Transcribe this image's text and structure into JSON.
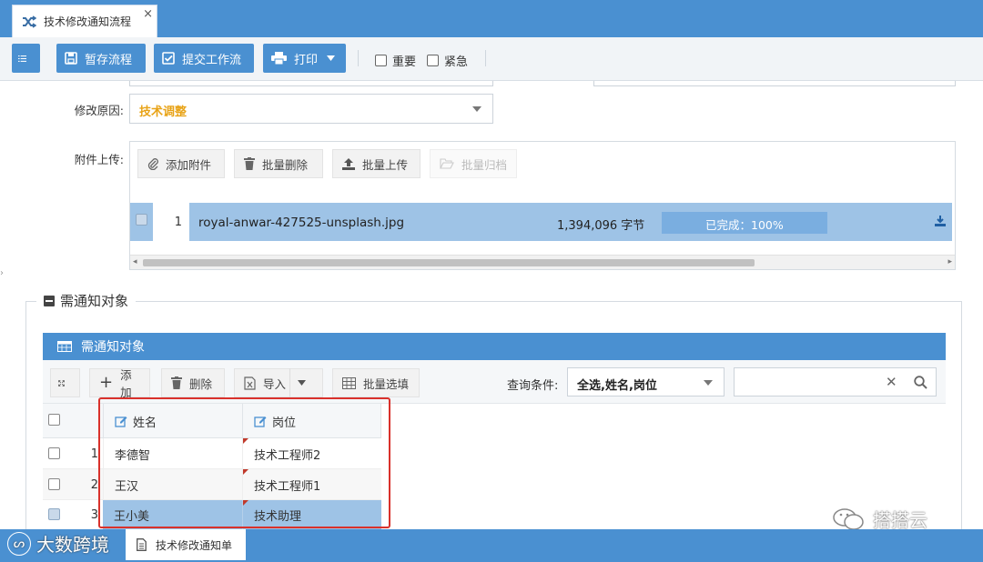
{
  "window": {
    "tab_title": "技术修改通知流程",
    "close_glyph": "×"
  },
  "toolbar": {
    "save_draft": "暂存流程",
    "submit": "提交工作流",
    "print": "打印",
    "important": "重要",
    "urgent": "紧急"
  },
  "form": {
    "reason_label": "修改原因:",
    "reason_value": "技术调整",
    "attach_label": "附件上传:",
    "attach_buttons": {
      "add": "添加附件",
      "batch_delete": "批量删除",
      "batch_upload": "批量上传",
      "batch_archive": "批量归档"
    },
    "file": {
      "index": "1",
      "name": "royal-anwar-427525-unsplash.jpg",
      "size": "1,394,096 字节",
      "status": "已完成：100%",
      "progress": 1.0
    }
  },
  "notify": {
    "section_title": "需通知对象",
    "panel_title": "需通知对象",
    "buttons": {
      "add": "添加",
      "delete": "删除",
      "import": "导入",
      "batch_fill": "批量选填"
    },
    "query_label": "查询条件:",
    "query_value": "全选,姓名,岗位",
    "columns": [
      "姓名",
      "岗位"
    ],
    "rows": [
      {
        "no": "1",
        "name": "李德智",
        "post": "技术工程师2",
        "checked": false
      },
      {
        "no": "2",
        "name": "王汉",
        "post": "技术工程师1",
        "checked": false
      },
      {
        "no": "3",
        "name": "王小美",
        "post": "技术助理",
        "checked": true
      }
    ]
  },
  "bottom": {
    "tab": "技术修改通知单",
    "watermark_left": "大数跨境",
    "watermark_right": "搭搭云"
  },
  "colors": {
    "primary": "#4a90d1",
    "highlight": "#9ec3e6",
    "reason_text": "#e8a317",
    "red_box": "#d9312b"
  }
}
